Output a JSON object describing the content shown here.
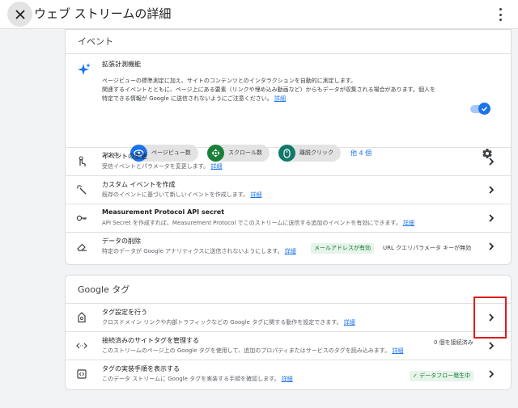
{
  "header": {
    "title": "ウェブ ストリームの詳細"
  },
  "events_card": {
    "title": "イベント",
    "enhanced": {
      "title": "拡張計測機能",
      "desc_line1": "ページビューの標準測定に加え、サイトのコンテンツとのインタラクションを自動的に測定します。",
      "desc_line2": "関連するイベントとともに、ページ上にある要素（リンクや埋め込み動画など）からもデータが収集される場合があります。個人を",
      "desc_line3": "特定できる情報が Google に送信されないようにご注意ください。",
      "desc_link": "詳細",
      "toggle_on": true,
      "measuring_label": "測定中:",
      "chips": [
        "ページビュー数",
        "スクロール数",
        "離脱クリック"
      ],
      "more_link": "他 4 個"
    },
    "rows": [
      {
        "title": "イベントの変更",
        "desc": "受信イベントとパラメータを変更します。",
        "link": "詳細"
      },
      {
        "title": "カスタム イベントを作成",
        "desc": "既存のイベントに基づいて新しいイベントを作成します。",
        "link": "詳細"
      },
      {
        "title": "Measurement Protocol API secret",
        "desc": "API Secret を作成すれば、Measurement Protocol でこのストリームに送信する追加のイベントを有効にできます。",
        "link": "詳細"
      },
      {
        "title": "データの削除",
        "desc": "特定のデータが Google アナリティクスに送信されないようにします。",
        "link": "詳細",
        "badge": "メールアドレスが有効",
        "extra": "URL クエリパラメータ キーが無効"
      }
    ]
  },
  "google_tag_card": {
    "title": "Google タグ",
    "rows": [
      {
        "title": "タグ設定を行う",
        "desc": "クロスドメイン リンクや内部トラフィックなどの Google タグに関する動作を設定できます。",
        "link": "詳細"
      },
      {
        "title": "接続済みのサイトタグを管理する",
        "desc": "このストリームのページ上の Google タグを使用して、追加のプロパティまたはサービスのタグを読み込みます。",
        "link": "詳細",
        "extra": "0 個を接続済み"
      },
      {
        "title": "タグの実装手順を表示する",
        "desc": "このデータ ストリームに Google タグを実装する手順を確認します。",
        "link": "詳細",
        "badge": "データフロー発生中"
      }
    ]
  },
  "colors": {
    "accent": "#1a73e8",
    "green": "#137333",
    "highlight": "#e01b1b"
  }
}
